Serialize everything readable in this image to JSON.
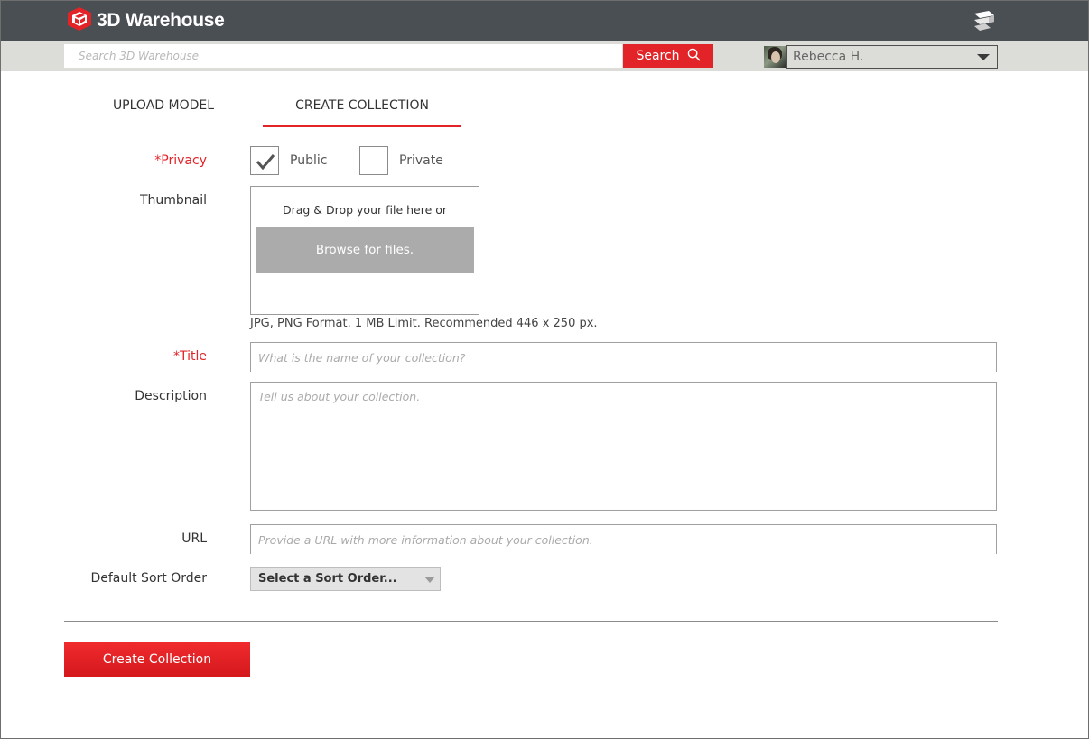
{
  "header": {
    "app_name": "3D Warehouse",
    "logo_icon": "warehouse-logo-icon",
    "menu_icon": "sketchup-menu-icon"
  },
  "search": {
    "placeholder": "Search 3D Warehouse",
    "button_label": "Search",
    "button_icon": "search-icon"
  },
  "user": {
    "name": "Rebecca H.",
    "avatar": "user-avatar"
  },
  "tabs": [
    {
      "label": "UPLOAD MODEL",
      "active": false
    },
    {
      "label": "CREATE COLLECTION",
      "active": true
    }
  ],
  "form": {
    "privacy": {
      "label": "*Privacy",
      "options": [
        {
          "label": "Public",
          "checked": true
        },
        {
          "label": "Private",
          "checked": false
        }
      ]
    },
    "thumbnail": {
      "label": "Thumbnail",
      "drop_text": "Drag & Drop your file here or",
      "browse_label": "Browse for files.",
      "hint": "JPG, PNG Format. 1 MB Limit. Recommended 446 x 250 px."
    },
    "title": {
      "label": "*Title",
      "value": "",
      "placeholder": "What is the name of your collection?"
    },
    "description": {
      "label": "Description",
      "value": "",
      "placeholder": "Tell us about your collection."
    },
    "url": {
      "label": "URL",
      "value": "",
      "placeholder": "Provide a URL with more information about your collection."
    },
    "sort_order": {
      "label": "Default Sort Order",
      "selected": "Select a Sort Order..."
    },
    "submit_label": "Create Collection"
  },
  "colors": {
    "accent_red": "#e22428",
    "header_bg": "#4a4f54",
    "search_strip_bg": "#dcdcd9",
    "browse_gray": "#ababab"
  }
}
